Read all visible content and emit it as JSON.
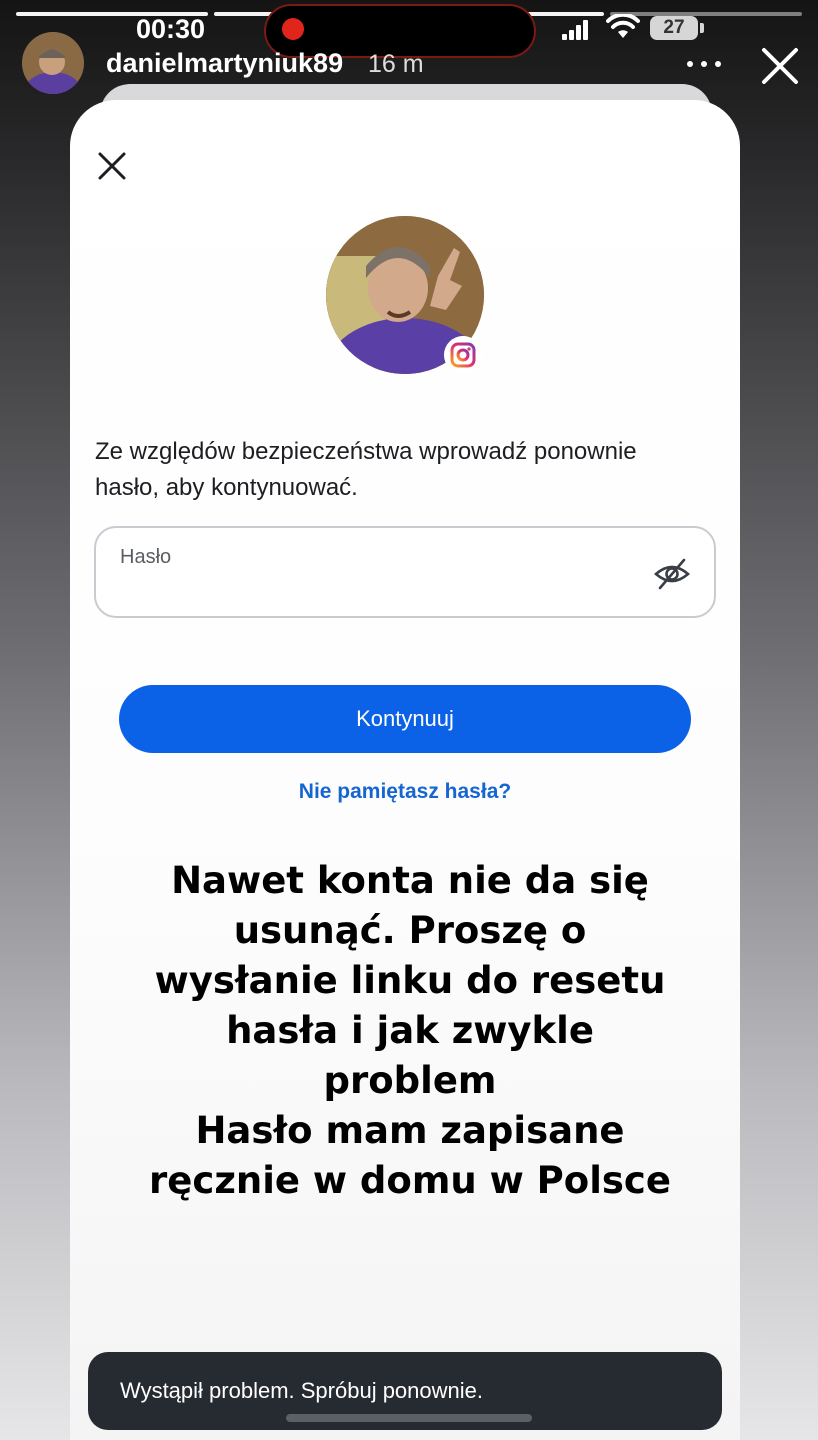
{
  "status_bar": {
    "time": "00:30",
    "battery": "27"
  },
  "story": {
    "username": "danielmartyniuk89",
    "time_ago": "16 m"
  },
  "dialog": {
    "prompt": "Ze względów bezpieczeństwa wprowadź ponownie hasło, aby kontynuować.",
    "password_label": "Hasło",
    "password_value": "",
    "continue_label": "Kontynuuj",
    "forgot_label": "Nie pamiętasz hasła?"
  },
  "story_text": {
    "line1": "Nawet konta nie da się",
    "line2": "usunąć. Proszę o",
    "line3": "wysłanie linku do resetu",
    "line4": "hasła i jak zwykle",
    "line5": "problem",
    "line6": "Hasło mam zapisane",
    "line7": "ręcznie w domu w Polsce"
  },
  "toast": {
    "message": "Wystąpił problem. Spróbuj ponownie."
  },
  "icons": {
    "story_close": "close-icon",
    "dialog_close": "close-icon",
    "menu": "more-horizontal-icon",
    "password_visibility": "eye-off-icon",
    "badge": "instagram-icon"
  },
  "colors": {
    "primary_button": "#0b62e6",
    "link": "#1566d1",
    "toast_bg": "#262a31",
    "record_dot": "#e0251b"
  }
}
